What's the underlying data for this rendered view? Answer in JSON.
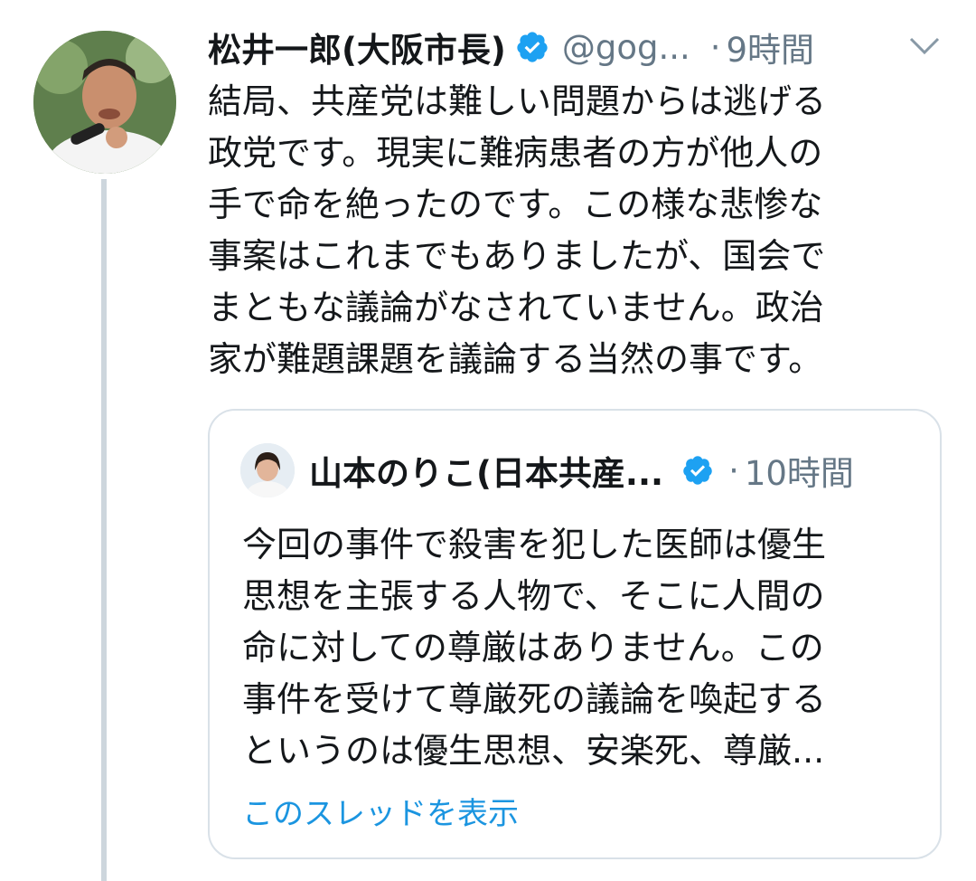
{
  "tweet": {
    "author_name": "松井一郎(大阪市長)",
    "handle": "@gog...",
    "separator": "·",
    "time": "9時間",
    "icons": {
      "verified": "verified-badge-icon",
      "menu": "chevron-down-icon"
    },
    "text_lines": [
      "結局、共産党は難しい問題からは逃げる",
      "政党です。現実に難病患者の方が他人の",
      "手で命を絶ったのです。この様な悲惨な",
      "事案はこれまでもありましたが、国会で",
      "まともな議論がなされていません。政治",
      "家が難題課題を議論する当然の事です。"
    ]
  },
  "quoted_tweet": {
    "author_name": "山本のりこ(日本共産...",
    "separator": "·",
    "time": "10時間",
    "text_lines": [
      "今回の事件で殺害を犯した医師は優生",
      "思想を主張する人物で、そこに人間の",
      "命に対しての尊厳はありません。この",
      "事件を受けて尊厳死の議論を喚起する",
      "というのは優生思想、安楽死、尊厳..."
    ],
    "show_thread_label": "このスレッドを表示"
  },
  "colors": {
    "verified": "#1da1f2",
    "link": "#1b95e0",
    "secondary_text": "#657786",
    "thread_line": "#cdd6dd"
  }
}
